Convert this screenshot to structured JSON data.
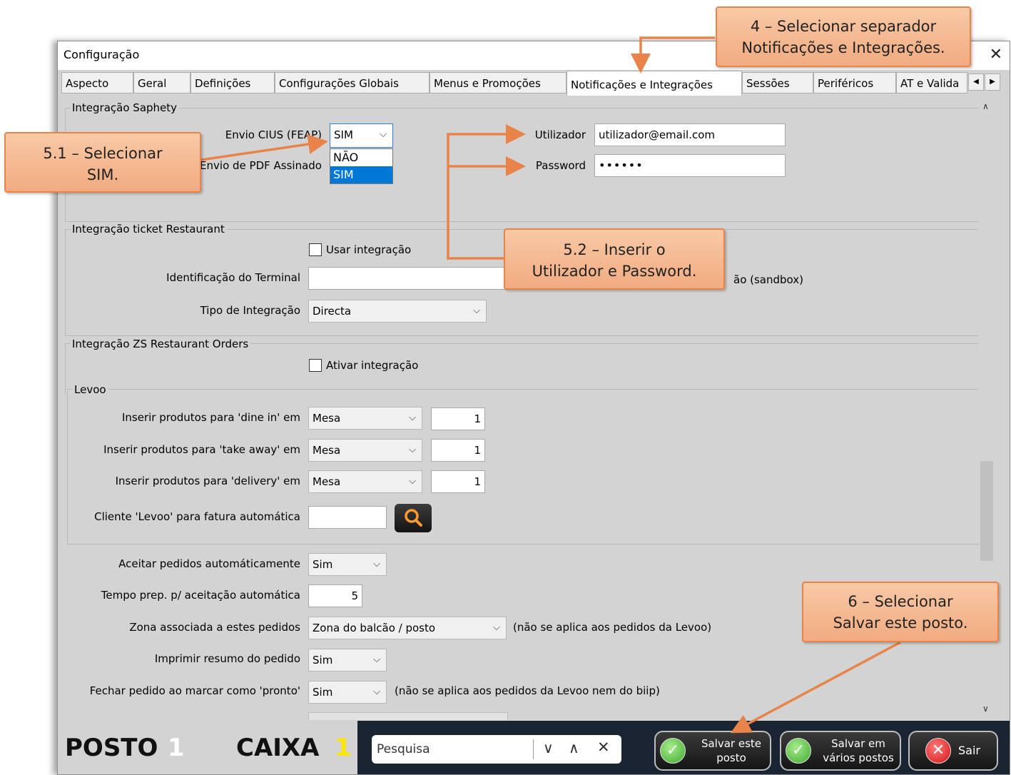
{
  "window": {
    "title": "Configuração",
    "close_glyph": "✕"
  },
  "tabs": [
    "Aspecto",
    "Geral",
    "Definições",
    "Configurações Globais",
    "Menus e Promoções",
    "Notificações e Integrações",
    "Sessões",
    "Periféricos",
    "AT e Valida"
  ],
  "active_tab": "Notificações e Integrações",
  "saphety": {
    "group_label": "Integração Saphety",
    "envio_cius_label": "Envio CIUS (FEAP)",
    "envio_cius_value": "SIM",
    "dropdown_options": [
      "NÃO",
      "SIM"
    ],
    "pdf_label": "Envio de PDF Assinado",
    "user_label": "Utilizador",
    "user_value": "utilizador@email.com",
    "password_label": "Password",
    "password_value": "••••••"
  },
  "ticket": {
    "group_label": "Integração ticket Restaurant",
    "use_label": "Usar integração",
    "terminal_label": "Identificação do Terminal",
    "sandbox_label": "ão (sandbox)",
    "tipo_label": "Tipo de Integração",
    "tipo_value": "Directa"
  },
  "zs": {
    "group_label": "Integração ZS Restaurant Orders",
    "ativar_label": "Ativar integração",
    "levoo_label": "Levoo",
    "dine_label": "Inserir produtos para 'dine in' em",
    "dine_value": "Mesa",
    "dine_num": "1",
    "take_label": "Inserir produtos para 'take away' em",
    "take_value": "Mesa",
    "take_num": "1",
    "delivery_label": "Inserir produtos para 'delivery' em",
    "delivery_value": "Mesa",
    "delivery_num": "1",
    "cliente_label": "Cliente 'Levoo' para fatura automática",
    "aceitar_label": "Aceitar pedidos automáticamente",
    "aceitar_value": "Sim",
    "tempo_label": "Tempo prep. p/ aceitação automática",
    "tempo_value": "5",
    "zona_label": "Zona associada a estes pedidos",
    "zona_value": "Zona do balcão / posto",
    "zona_note": "(não se aplica aos pedidos da Levoo)",
    "imprimir_label": "Imprimir resumo do pedido",
    "imprimir_value": "Sim",
    "fechar_label": "Fechar pedido ao marcar como 'pronto'",
    "fechar_value": "Sim",
    "fechar_note": "(não se aplica aos pedidos da Levoo nem do biip)"
  },
  "bottom": {
    "posto_label": "POSTO",
    "posto_num": "1",
    "caixa_label": "CAIXA",
    "caixa_num": "1",
    "search_placeholder": "Pesquisa",
    "save_line1": "Salvar este",
    "save_line2": "posto",
    "save_multi_line1": "Salvar em",
    "save_multi_line2": "vários postos",
    "exit_label": "Sair"
  },
  "callouts": {
    "c4_line1": "4 – Selecionar separador",
    "c4_line2": "Notificações e Integrações.",
    "c51_line1": "5.1 – Selecionar",
    "c51_line2": "SIM.",
    "c52_line1": "5.2 – Inserir o",
    "c52_line2": "Utilizador e Password.",
    "c6_line1": "6 – Selecionar",
    "c6_line2": "Salvar este posto."
  },
  "colors": {
    "accent_orange": "#e8844a",
    "callout_fill": "#f6bd95",
    "dropdown_select": "#0078d7",
    "bottom_bar": "#1b2433",
    "caixa_num": "#ffe600"
  },
  "icons": [
    "close-icon",
    "chevron-down-icon",
    "search-icon",
    "check-icon",
    "x-icon",
    "chevron-up-icon"
  ]
}
